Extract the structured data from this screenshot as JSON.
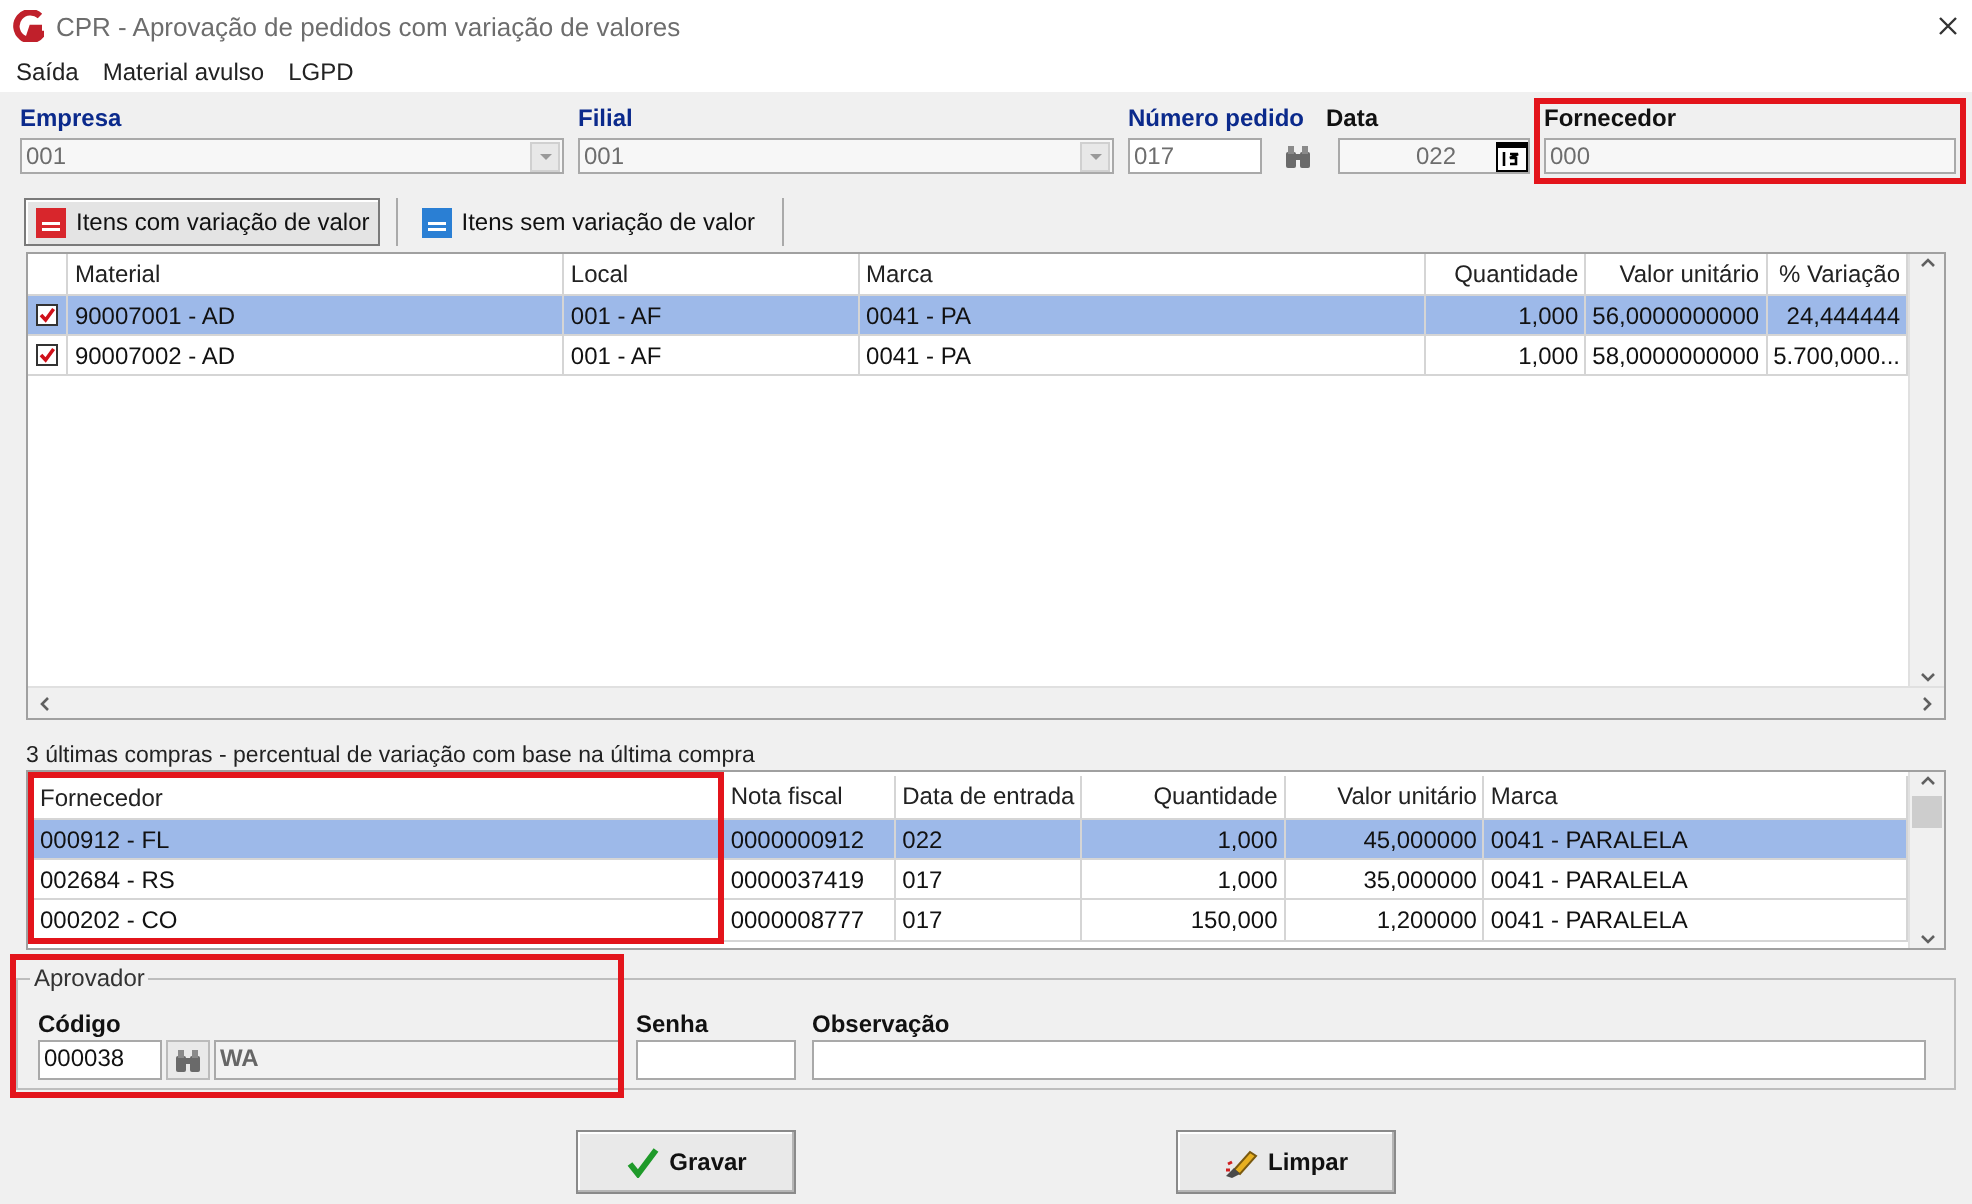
{
  "window": {
    "title": "CPR - Aprovação de pedidos com variação de valores"
  },
  "menu": [
    {
      "label": "Saída"
    },
    {
      "label": "Material avulso"
    },
    {
      "label": "LGPD"
    }
  ],
  "header_fields": [
    {
      "kind": "combo",
      "label": "Empresa",
      "required": true,
      "highlighted": false,
      "value": "001"
    },
    {
      "kind": "combo",
      "label": "Filial",
      "required": true,
      "highlighted": false,
      "value": "001"
    },
    {
      "kind": "search",
      "label": "Número pedido",
      "required": true,
      "highlighted": false,
      "value": "017"
    },
    {
      "kind": "date",
      "label": "Data",
      "required": false,
      "highlighted": false,
      "value": "022"
    },
    {
      "kind": "text",
      "label": "Fornecedor",
      "required": false,
      "highlighted": true,
      "value": "000"
    }
  ],
  "tabs": [
    {
      "label": "Itens com variação de valor",
      "selected": true,
      "color": "#d8262c"
    },
    {
      "label": "Itens sem variação de valor",
      "selected": false,
      "color": "#2a7fd4"
    }
  ],
  "items_grid": {
    "columns": [
      {
        "label": "Material",
        "highlighted": false
      },
      {
        "label": "Local",
        "highlighted": false
      },
      {
        "label": "Marca",
        "highlighted": false
      },
      {
        "label": "Quantidade",
        "highlighted": false
      },
      {
        "label": "Valor unitário",
        "highlighted": false
      },
      {
        "label": "% Variação",
        "highlighted": false
      }
    ],
    "rows": [
      {
        "checked": true,
        "selected": true,
        "cells": [
          "90007001 - AD",
          "001 - AF",
          "0041 - PA",
          "1,000",
          "56,0000000000",
          "24,444444"
        ]
      },
      {
        "checked": true,
        "selected": false,
        "cells": [
          "90007002 - AD",
          "001 - AF",
          "0041 - PA",
          "1,000",
          "58,0000000000",
          "5.700,000..."
        ]
      }
    ]
  },
  "history_caption": "3 últimas compras - percentual de variação com base na última compra",
  "history_grid": {
    "columns": [
      {
        "label": "Fornecedor",
        "highlighted": true
      },
      {
        "label": "Nota fiscal",
        "highlighted": false
      },
      {
        "label": "Data de entrada",
        "highlighted": false
      },
      {
        "label": "Quantidade",
        "highlighted": false
      },
      {
        "label": "Valor unitário",
        "highlighted": false
      },
      {
        "label": "Marca",
        "highlighted": false
      }
    ],
    "rows": [
      {
        "selected": true,
        "cells": [
          "000912 - FL",
          "0000000912",
          "022",
          "1,000",
          "45,000000",
          "0041 - PARALELA"
        ]
      },
      {
        "selected": false,
        "cells": [
          "002684 - RS",
          "0000037419",
          "017",
          "1,000",
          "35,000000",
          "0041 - PARALELA"
        ]
      },
      {
        "selected": false,
        "cells": [
          "000202 - CO",
          "0000008777",
          "017",
          "150,000",
          "1,200000",
          "0041 - PARALELA"
        ]
      }
    ]
  },
  "approver": {
    "legend": "Aprovador",
    "highlighted": true,
    "code_label": "Código",
    "code": "000038",
    "name": "WA"
  },
  "password": {
    "label": "Senha"
  },
  "notes": {
    "label": "Observação"
  },
  "buttons": [
    {
      "kind": "save",
      "label": "Gravar"
    },
    {
      "kind": "clear",
      "label": "Limpar"
    }
  ]
}
